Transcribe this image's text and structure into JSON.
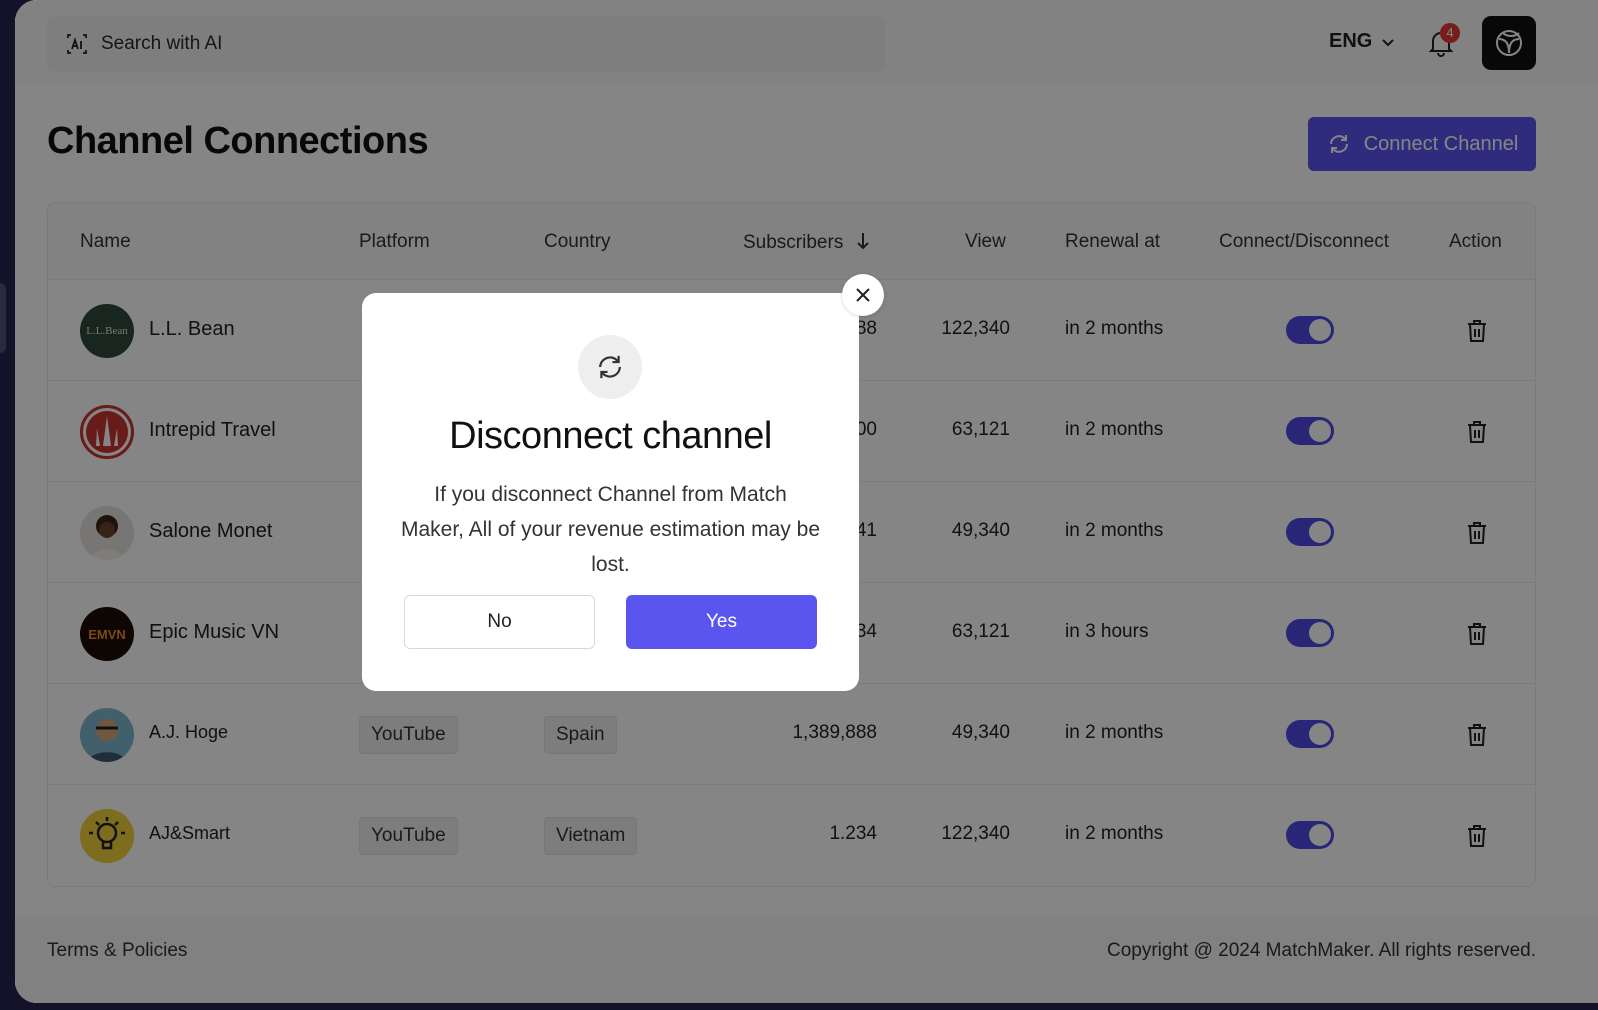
{
  "topbar": {
    "search_placeholder": "Search with AI",
    "language": "ENG",
    "notification_count": "4"
  },
  "header": {
    "title": "Channel Connections",
    "connect_label": "Connect Channel"
  },
  "table": {
    "columns": [
      "Name",
      "Platform",
      "Country",
      "Subscribers",
      "View",
      "Renewal at",
      "Connect/Disconnect",
      "Action"
    ],
    "rows": [
      {
        "name": "L.L. Bean",
        "avatar_text": "L.L.Bean",
        "subscribers": "88",
        "view": "122,340",
        "renewal": "in 2 months",
        "connected": true
      },
      {
        "name": "Intrepid Travel",
        "subscribers": "00",
        "view": "63,121",
        "renewal": "in 2 months",
        "connected": true
      },
      {
        "name": "Salone Monet",
        "subscribers": "41",
        "view": "49,340",
        "renewal": "in 2 months",
        "connected": true
      },
      {
        "name": "Epic Music VN",
        "avatar_text": "EMVN",
        "subscribers": "34",
        "view": "63,121",
        "renewal": "in 3 hours",
        "connected": true
      },
      {
        "name": "A.J. Hoge",
        "platform": "YouTube",
        "country": "Spain",
        "subscribers": "1,389,888",
        "view": "49,340",
        "renewal": "in 2 months",
        "connected": true
      },
      {
        "name": "AJ&Smart",
        "platform": "YouTube",
        "country": "Vietnam",
        "subscribers": "1.234",
        "view": "122,340",
        "renewal": "in 2 months",
        "connected": true
      }
    ]
  },
  "footer": {
    "terms": "Terms & Policies",
    "copyright": "Copyright @ 2024 MatchMaker. All rights reserved."
  },
  "modal": {
    "title": "Disconnect channel",
    "message": "If you disconnect Channel from Match Maker,  All of your revenue estimation may be lost.",
    "no_label": "No",
    "yes_label": "Yes"
  },
  "colors": {
    "accent": "#5b55f0",
    "toggle_on": "#4f49e6",
    "badge": "#e53935"
  }
}
